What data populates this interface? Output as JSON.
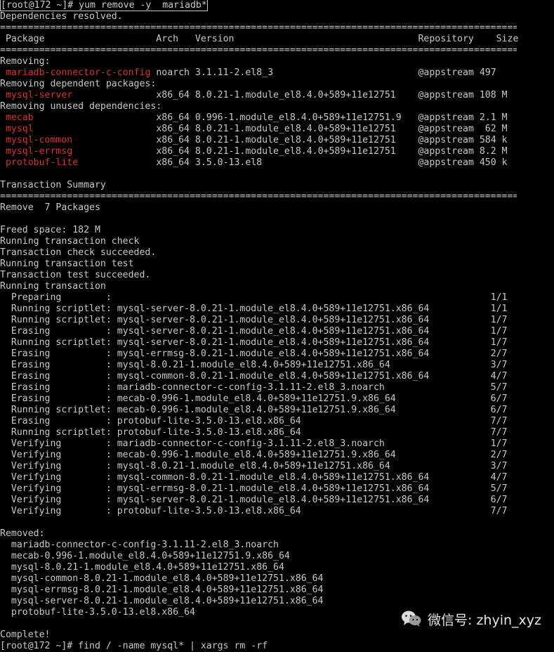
{
  "terminal": {
    "prompt": "[root@172 ~]# yum remove -y  mariadb*",
    "resolved": "Dependencies resolved.",
    "separator": "================================================================================================",
    "header": {
      "package": "Package",
      "arch": "Arch",
      "version": "Version",
      "repository": "Repository",
      "size": "Size"
    },
    "sections": [
      {
        "label": "Removing:",
        "rows": [
          {
            "name": "mariadb-connector-c-config",
            "arch": "noarch",
            "version": "3.1.11-2.el8_3",
            "repo": "@appstream",
            "size": "497"
          }
        ]
      },
      {
        "label": "Removing dependent packages:",
        "rows": [
          {
            "name": "mysql-server",
            "arch": "x86_64",
            "version": "8.0.21-1.module_el8.4.0+589+11e12751",
            "repo": "@appstream",
            "size": "108 M"
          }
        ]
      },
      {
        "label": "Removing unused dependencies:",
        "rows": [
          {
            "name": "mecab",
            "arch": "x86_64",
            "version": "0.996-1.module_el8.4.0+589+11e12751.9",
            "repo": "@appstream",
            "size": "2.1 M"
          },
          {
            "name": "mysql",
            "arch": "x86_64",
            "version": "8.0.21-1.module_el8.4.0+589+11e12751",
            "repo": "@appstream",
            "size": " 62 M"
          },
          {
            "name": "mysql-common",
            "arch": "x86_64",
            "version": "8.0.21-1.module_el8.4.0+589+11e12751",
            "repo": "@appstream",
            "size": "584 k"
          },
          {
            "name": "mysql-errmsg",
            "arch": "x86_64",
            "version": "8.0.21-1.module_el8.4.0+589+11e12751",
            "repo": "@appstream",
            "size": "8.2 M"
          },
          {
            "name": "protobuf-lite",
            "arch": "x86_64",
            "version": "3.5.0-13.el8",
            "repo": "@appstream",
            "size": "450 k"
          }
        ]
      }
    ],
    "summary_title": "Transaction Summary",
    "remove_line": "Remove  7 Packages",
    "freed": "Freed space: 182 M",
    "status_lines": [
      "Running transaction check",
      "Transaction check succeeded.",
      "Running transaction test",
      "Transaction test succeeded.",
      "Running transaction"
    ],
    "steps": [
      {
        "action": "Preparing",
        "pkg": "",
        "count": "1/1"
      },
      {
        "action": "Running scriptlet",
        "pkg": "mysql-server-8.0.21-1.module_el8.4.0+589+11e12751.x86_64",
        "count": "1/1"
      },
      {
        "action": "Running scriptlet",
        "pkg": "mysql-server-8.0.21-1.module_el8.4.0+589+11e12751.x86_64",
        "count": "1/7"
      },
      {
        "action": "Erasing",
        "pkg": "mysql-server-8.0.21-1.module_el8.4.0+589+11e12751.x86_64",
        "count": "1/7"
      },
      {
        "action": "Running scriptlet",
        "pkg": "mysql-server-8.0.21-1.module_el8.4.0+589+11e12751.x86_64",
        "count": "1/7"
      },
      {
        "action": "Erasing",
        "pkg": "mysql-errmsg-8.0.21-1.module_el8.4.0+589+11e12751.x86_64",
        "count": "2/7"
      },
      {
        "action": "Erasing",
        "pkg": "mysql-8.0.21-1.module_el8.4.0+589+11e12751.x86_64",
        "count": "3/7"
      },
      {
        "action": "Erasing",
        "pkg": "mysql-common-8.0.21-1.module_el8.4.0+589+11e12751.x86_64",
        "count": "4/7"
      },
      {
        "action": "Erasing",
        "pkg": "mariadb-connector-c-config-3.1.11-2.el8_3.noarch",
        "count": "5/7"
      },
      {
        "action": "Erasing",
        "pkg": "mecab-0.996-1.module_el8.4.0+589+11e12751.9.x86_64",
        "count": "6/7"
      },
      {
        "action": "Running scriptlet",
        "pkg": "mecab-0.996-1.module_el8.4.0+589+11e12751.9.x86_64",
        "count": "6/7"
      },
      {
        "action": "Erasing",
        "pkg": "protobuf-lite-3.5.0-13.el8.x86_64",
        "count": "7/7"
      },
      {
        "action": "Running scriptlet",
        "pkg": "protobuf-lite-3.5.0-13.el8.x86_64",
        "count": "7/7"
      },
      {
        "action": "Verifying",
        "pkg": "mariadb-connector-c-config-3.1.11-2.el8_3.noarch",
        "count": "1/7"
      },
      {
        "action": "Verifying",
        "pkg": "mecab-0.996-1.module_el8.4.0+589+11e12751.9.x86_64",
        "count": "2/7"
      },
      {
        "action": "Verifying",
        "pkg": "mysql-8.0.21-1.module_el8.4.0+589+11e12751.x86_64",
        "count": "3/7"
      },
      {
        "action": "Verifying",
        "pkg": "mysql-common-8.0.21-1.module_el8.4.0+589+11e12751.x86_64",
        "count": "4/7"
      },
      {
        "action": "Verifying",
        "pkg": "mysql-errmsg-8.0.21-1.module_el8.4.0+589+11e12751.x86_64",
        "count": "5/7"
      },
      {
        "action": "Verifying",
        "pkg": "mysql-server-8.0.21-1.module_el8.4.0+589+11e12751.x86_64",
        "count": "6/7"
      },
      {
        "action": "Verifying",
        "pkg": "protobuf-lite-3.5.0-13.el8.x86_64",
        "count": "7/7"
      }
    ],
    "removed_title": "Removed:",
    "removed": [
      "mariadb-connector-c-config-3.1.11-2.el8_3.noarch",
      "mecab-0.996-1.module_el8.4.0+589+11e12751.9.x86_64",
      "mysql-8.0.21-1.module_el8.4.0+589+11e12751.x86_64",
      "mysql-common-8.0.21-1.module_el8.4.0+589+11e12751.x86_64",
      "mysql-errmsg-8.0.21-1.module_el8.4.0+589+11e12751.x86_64",
      "mysql-server-8.0.21-1.module_el8.4.0+589+11e12751.x86_64",
      "protobuf-lite-3.5.0-13.el8.x86_64"
    ],
    "complete": "Complete!",
    "next_prompt": "[root@172 ~]# find / -name mysql* | xargs rm -rf"
  },
  "watermark": {
    "icon": "wechat-icon",
    "text": "微信号: zhyin_xyz"
  },
  "colors": {
    "background": "#000000",
    "text": "#c8c8c8",
    "package_name": "#d83232"
  }
}
